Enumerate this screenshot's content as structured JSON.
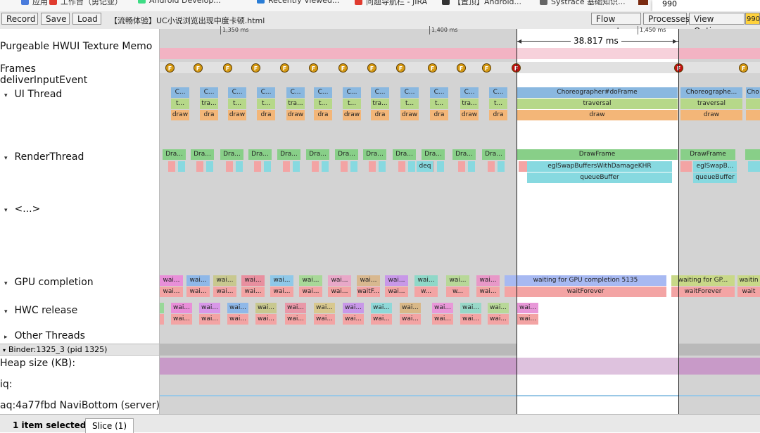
{
  "bookmarks": [
    {
      "label": "应用",
      "color": "#4a7cdc"
    },
    {
      "label": "工作台（勇记亚）",
      "color": "#e03b2f"
    },
    {
      "label": "Android Develop...",
      "color": "#3ddc84"
    },
    {
      "label": "Recently Viewed...",
      "color": "#2a7dd6"
    },
    {
      "label": "问题导航栏 - JIRA",
      "color": "#e03b2f"
    },
    {
      "label": "【置顶】Android...",
      "color": "#333333"
    },
    {
      "label": "Systrace 基础知识...",
      "color": "#666666"
    }
  ],
  "popup": {
    "value": "990"
  },
  "toolbar": {
    "record": "Record",
    "save": "Save",
    "load": "Load",
    "filename": "【流畅体验】UC小说浏览出现中度卡顿.html",
    "flow_events": "Flow events",
    "processes": "Processes",
    "view_options": "View Options",
    "search_value": "990"
  },
  "ruler": {
    "ticks": [
      {
        "label": "1,350 ms"
      },
      {
        "label": "1,400 ms"
      },
      {
        "label": "1,450 ms"
      }
    ],
    "selection_label": "38.817 ms"
  },
  "tracks": {
    "purgeable": "Purgeable HWUI Texture Memo",
    "frames": "Frames",
    "deliver": "deliverInputEvent",
    "ui_thread": "UI Thread",
    "render_thread": "RenderThread",
    "collapsed": "<...>",
    "gpu_completion": "GPU completion",
    "hwc_release": "HWC release",
    "other_threads": "Other Threads",
    "binder": "Binder:1325_3 (pid 1325)",
    "heap": "Heap size (KB):",
    "iq": "iq:",
    "navi": "aq:4a77fbd NaviBottom (server)"
  },
  "frames": {
    "letter": "F"
  },
  "ui_events": {
    "choreographer_short": "C...",
    "traversal_short": "tra...",
    "t_short": "t...",
    "draw_short": "draw",
    "dra_short": "dra",
    "choreographer": "Choreographer#doFrame",
    "traversal": "traversal",
    "draw": "draw",
    "choreographer_b": "Choreographe...",
    "cho": "Cho"
  },
  "render_events": {
    "dra_short": "Dra...",
    "deq": "deq",
    "drawframe": "DrawFrame",
    "eglswap": "eglSwapBuffersWithDamageKHR",
    "queuebuffer": "queueBuffer",
    "eglswap_b": "eglSwapB..."
  },
  "gpu_events": {
    "wai": "wai...",
    "w": "w...",
    "waitf": "waitF...",
    "waiting_main": "waiting for GPU completion 5135",
    "waitforever": "waitForever",
    "waiting_b": "waiting for GP...",
    "waitin": "waitin",
    "wait": "wait"
  },
  "hwc_events": {
    "wai": "wai..."
  },
  "status": {
    "selected": "1 item selected.",
    "tab": "Slice (1)"
  },
  "colors": {
    "selection_bg": "#ffffff",
    "track_bg": "#d3d3d3",
    "memo_pink": "#f2b3c3",
    "heap_purple": "#c89ac8",
    "frame_gold": "#d69a12",
    "frame_red": "#c41010",
    "ui_blue": "#8ab8e0",
    "ui_green": "#b6d889",
    "ui_orange": "#f3b678",
    "render_green": "#88cf88",
    "render_cyan": "#87d9e0",
    "gpu_blue": "#a7b9f2",
    "gpu_pink": "#f3a4a4"
  }
}
